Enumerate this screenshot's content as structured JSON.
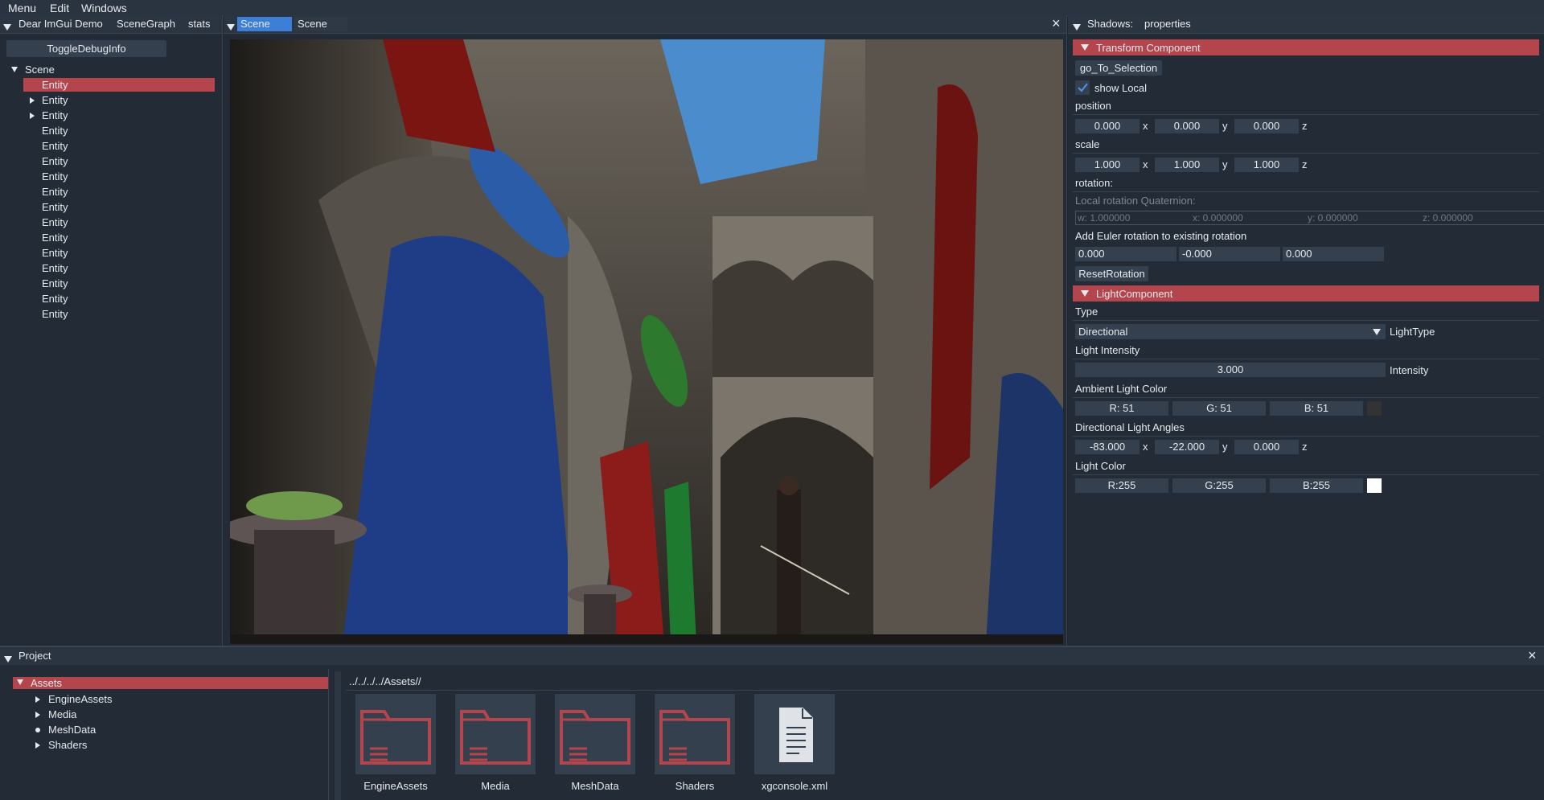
{
  "menubar": {
    "items": [
      "Menu",
      "Edit",
      "Windows"
    ]
  },
  "left_panel": {
    "tabs": [
      "Dear ImGui Demo",
      "SceneGraph",
      "stats"
    ],
    "toggle_button": "ToggleDebugInfo",
    "root_label": "Scene",
    "entities": [
      {
        "label": "Entity",
        "selected": true,
        "arrow": "none"
      },
      {
        "label": "Entity",
        "selected": false,
        "arrow": "right"
      },
      {
        "label": "Entity",
        "selected": false,
        "arrow": "right"
      },
      {
        "label": "Entity",
        "selected": false,
        "arrow": "none"
      },
      {
        "label": "Entity",
        "selected": false,
        "arrow": "none"
      },
      {
        "label": "Entity",
        "selected": false,
        "arrow": "none"
      },
      {
        "label": "Entity",
        "selected": false,
        "arrow": "none"
      },
      {
        "label": "Entity",
        "selected": false,
        "arrow": "none"
      },
      {
        "label": "Entity",
        "selected": false,
        "arrow": "none"
      },
      {
        "label": "Entity",
        "selected": false,
        "arrow": "none"
      },
      {
        "label": "Entity",
        "selected": false,
        "arrow": "none"
      },
      {
        "label": "Entity",
        "selected": false,
        "arrow": "none"
      },
      {
        "label": "Entity",
        "selected": false,
        "arrow": "none"
      },
      {
        "label": "Entity",
        "selected": false,
        "arrow": "none"
      },
      {
        "label": "Entity",
        "selected": false,
        "arrow": "none"
      },
      {
        "label": "Entity",
        "selected": false,
        "arrow": "none"
      }
    ]
  },
  "scene_panel": {
    "tabs": [
      "Scene",
      "Scene"
    ],
    "close_glyph": "×"
  },
  "properties": {
    "title_left": "Shadows:",
    "title_right": "properties",
    "transform_header": "Transform Component",
    "go_to_selection": "go_To_Selection",
    "show_local_label": "show Local",
    "show_local_checked": true,
    "position_label": "position",
    "position": [
      "0.000",
      "0.000",
      "0.000"
    ],
    "scale_label": "scale",
    "scale": [
      "1.000",
      "1.000",
      "1.000"
    ],
    "axis_x": "x",
    "axis_y": "y",
    "axis_z": "z",
    "rotation_label": "rotation:",
    "local_rotation_label": "Local rotation Quaternion:",
    "quaternion": [
      "w: 1.000000",
      "x: 0.000000",
      "y: 0.000000",
      "z: 0.000000"
    ],
    "euler_label": "Add Euler rotation to existing rotation",
    "euler": [
      "0.000",
      "-0.000",
      "0.000"
    ],
    "reset_rotation": "ResetRotation",
    "light_header": "LightComponent",
    "type_label": "Type",
    "type_value": "Directional",
    "type_suffix": "LightType",
    "intensity_label": "Light Intensity",
    "intensity_value": "3.000",
    "intensity_suffix": "Intensity",
    "ambient_label": "Ambient Light Color",
    "ambient": [
      "R: 51",
      "G: 51",
      "B: 51"
    ],
    "ambient_swatch": "#333333",
    "angles_label": "Directional Light Angles",
    "angles": [
      "-83.000",
      "-22.000",
      "0.000"
    ],
    "light_color_label": "Light Color",
    "light_color": [
      "R:255",
      "G:255",
      "B:255"
    ],
    "light_swatch": "#ffffff"
  },
  "project_panel": {
    "title": "Project",
    "close_glyph": "×",
    "tree_root": "Assets",
    "tree_children": [
      {
        "label": "EngineAssets",
        "marker": "arrow"
      },
      {
        "label": "Media",
        "marker": "arrow"
      },
      {
        "label": "MeshData",
        "marker": "bullet"
      },
      {
        "label": "Shaders",
        "marker": "arrow"
      }
    ],
    "path": "../../../../Assets//",
    "tiles": [
      {
        "label": "EngineAssets",
        "kind": "folder-icon"
      },
      {
        "label": "Media",
        "kind": "folder-icon"
      },
      {
        "label": "MeshData",
        "kind": "folder-icon"
      },
      {
        "label": "Shaders",
        "kind": "folder-icon"
      },
      {
        "label": "xgconsole.xml",
        "kind": "file-icon"
      }
    ]
  },
  "colors": {
    "accent_red": "#b4454d",
    "tab_active": "#3d7fd6",
    "checkbox": "#4a8ee8"
  }
}
